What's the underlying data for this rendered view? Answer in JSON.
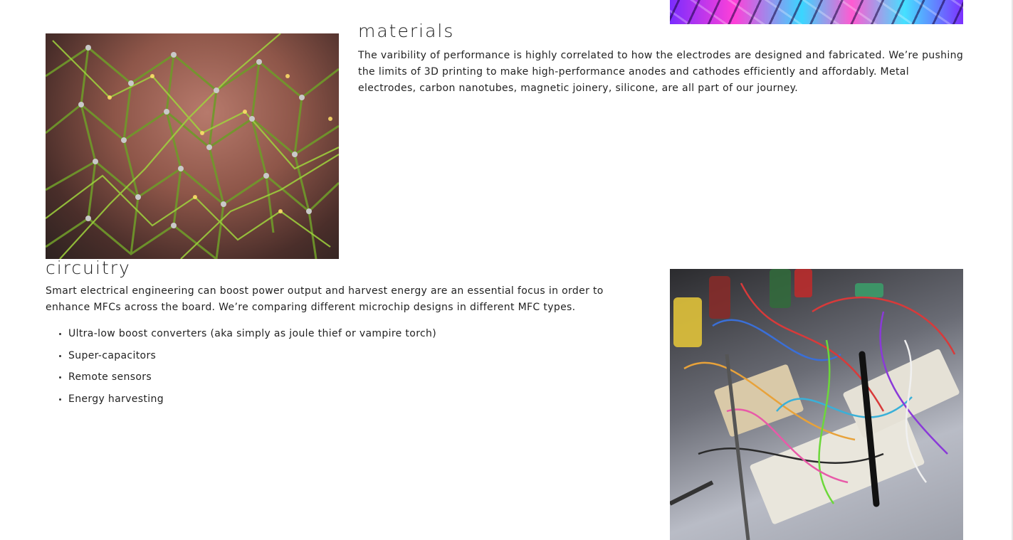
{
  "materials": {
    "heading": "materials",
    "paragraph": "The varibility of performance is highly correlated to how the electrodes are designed and fabricated. We’re pushing the limits of 3D printing to make high-performance anodes and cathodes efficiently and affordably. Metal electrodes, carbon nanotubes, magnetic joinery, silicone, are all part of our journey."
  },
  "circuitry": {
    "heading": "circuitry",
    "paragraph": "Smart electrical engineering can boost power output and harvest energy are an essential focus in order to enhance MFCs across the board. We’re comparing different microchip designs in different MFC types.",
    "list": [
      "Ultra-low boost converters (aka simply as joule thief or vampire torch)",
      "Super-capacitors",
      "Remote sensors",
      "Energy harvesting"
    ]
  },
  "colors": {
    "background": "#ffffff",
    "text": "#222222"
  }
}
